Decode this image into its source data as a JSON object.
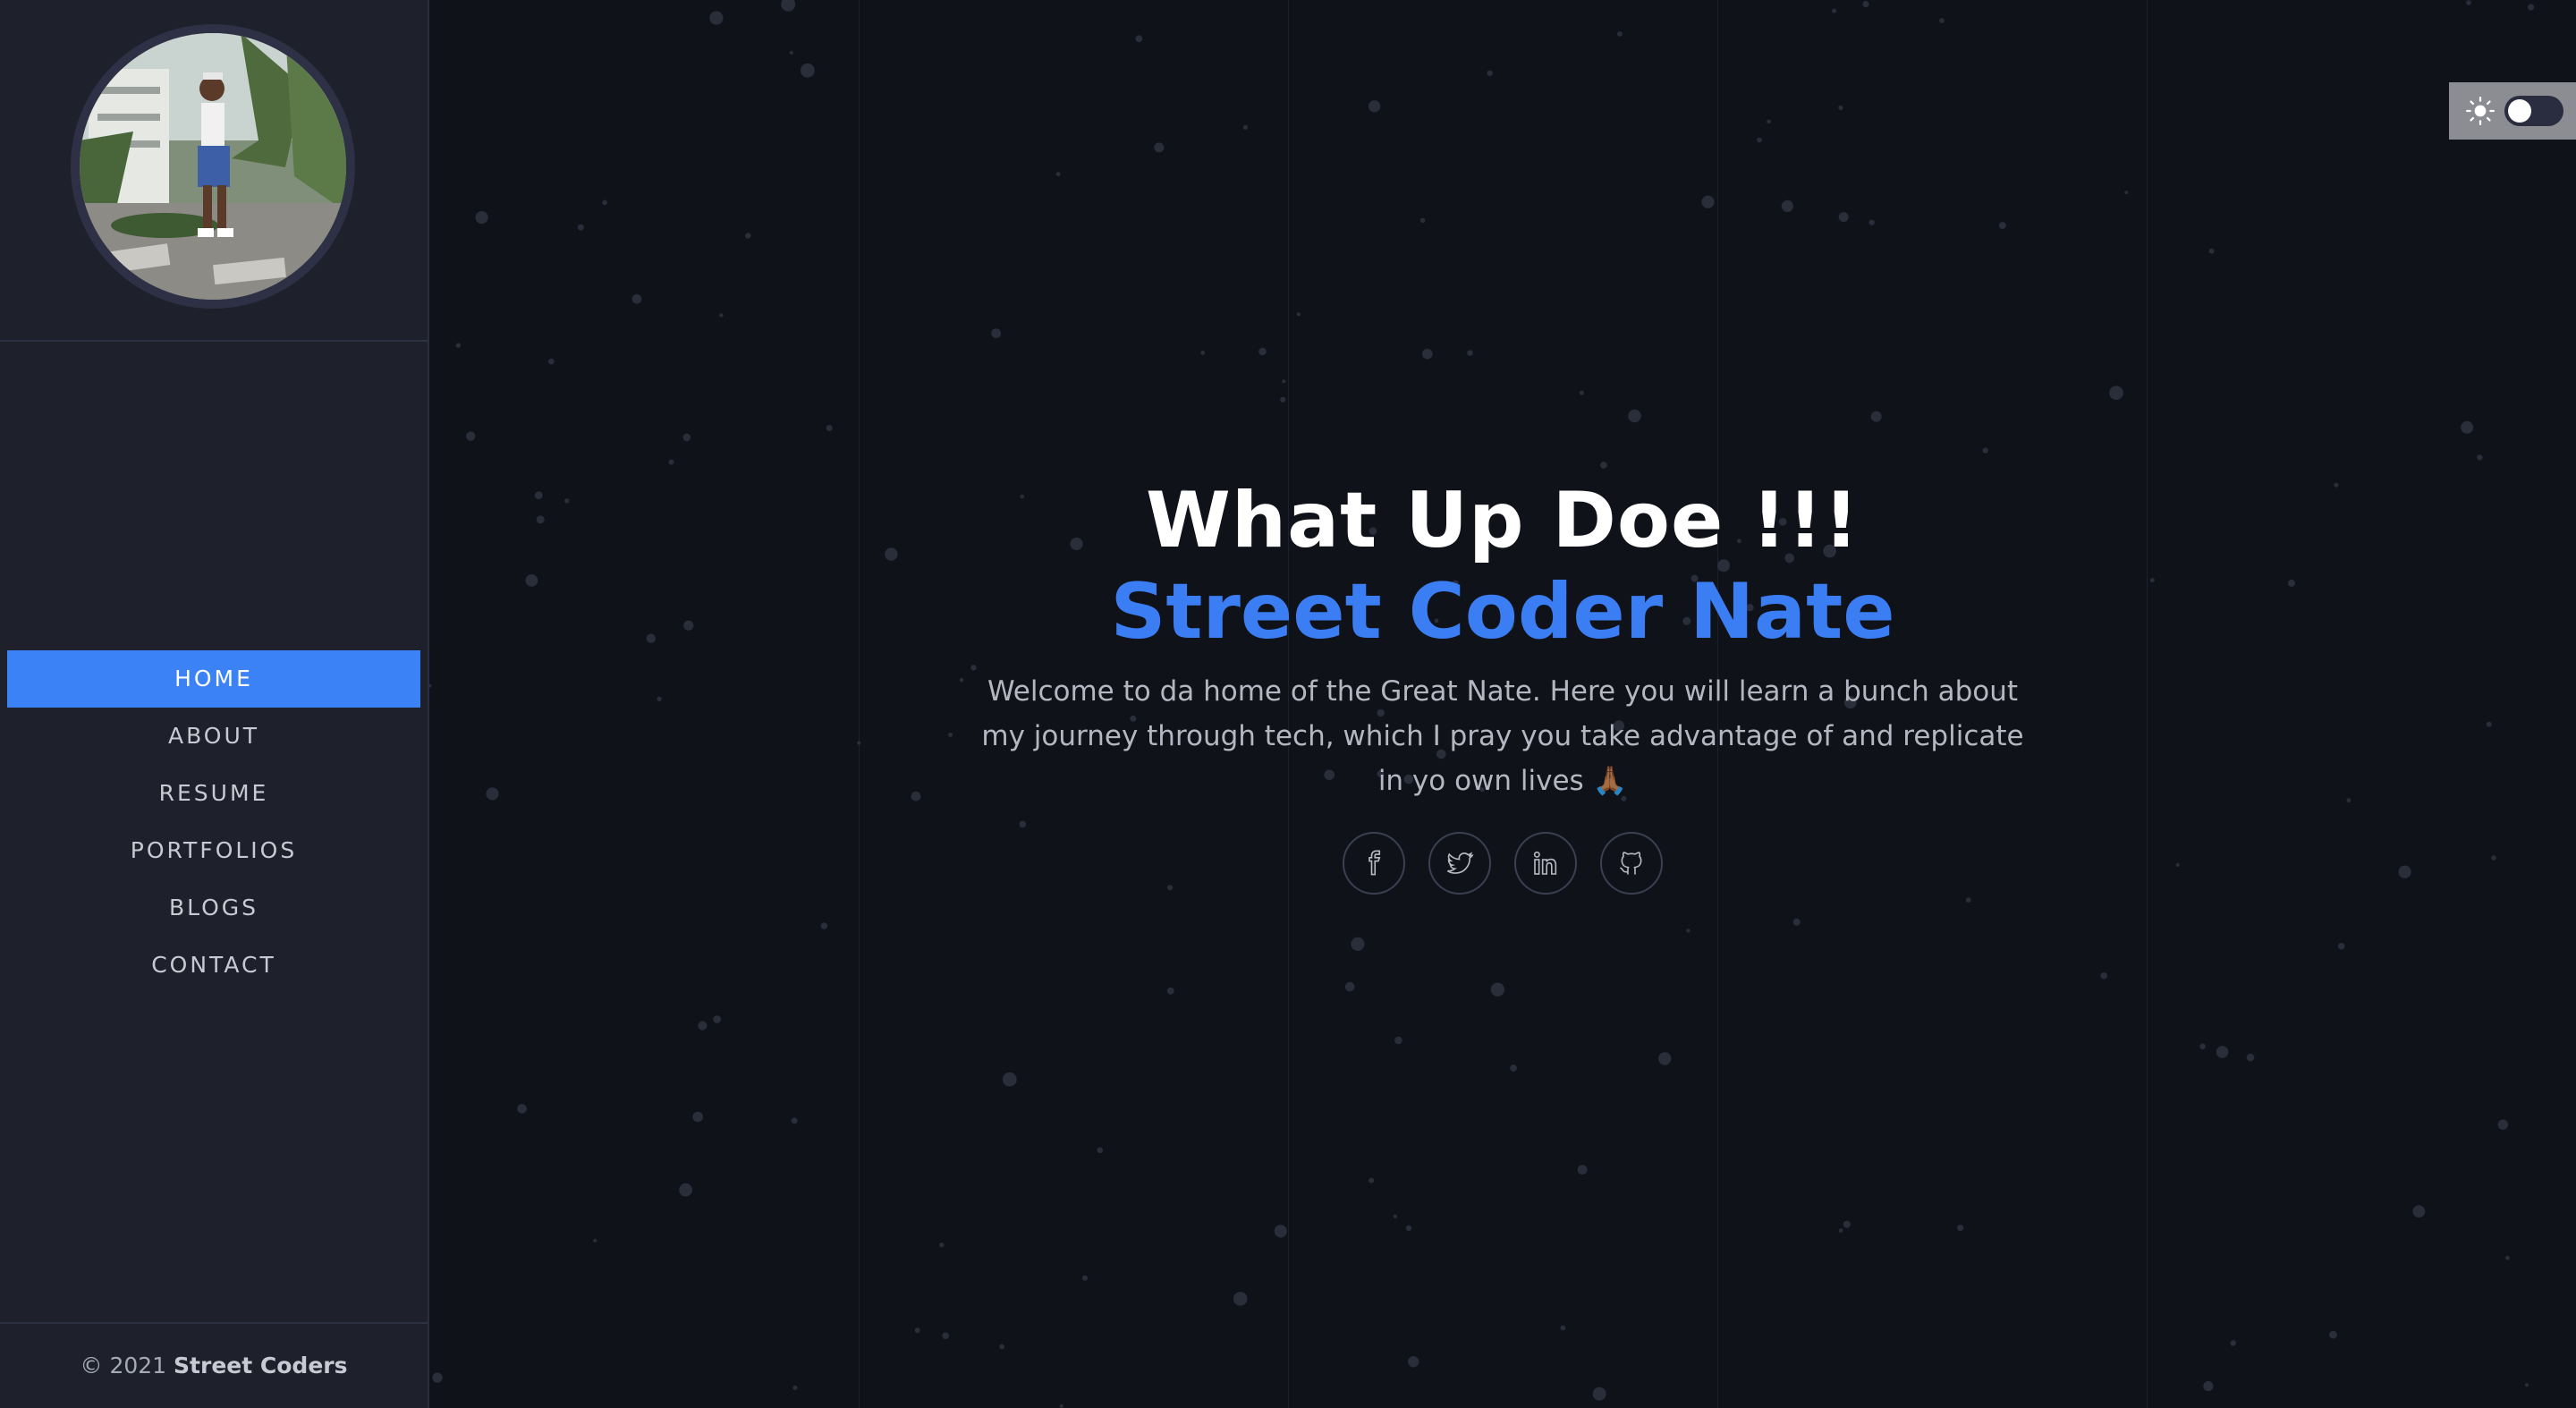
{
  "sidebar": {
    "nav": [
      {
        "label": "Home",
        "active": true
      },
      {
        "label": "About",
        "active": false
      },
      {
        "label": "Resume",
        "active": false
      },
      {
        "label": "Portfolios",
        "active": false
      },
      {
        "label": "Blogs",
        "active": false
      },
      {
        "label": "Contact",
        "active": false
      }
    ],
    "footer": {
      "copyright": "© 2021",
      "brand": "Street Coders"
    }
  },
  "hero": {
    "title": "What Up Doe !!!",
    "name": "Street Coder Nate",
    "text": "Welcome to da home of the Great Nate. Here you will learn a bunch about my journey through tech, which I pray you take advantage of and replicate in yo own lives 🙏🏾"
  },
  "socials": [
    {
      "icon": "facebook-icon"
    },
    {
      "icon": "twitter-icon"
    },
    {
      "icon": "linkedin-icon"
    },
    {
      "icon": "github-icon"
    }
  ],
  "theme_toggle": {
    "icon": "sun-icon",
    "dark_mode": true
  },
  "colors": {
    "accent": "#3b82f6",
    "background": "#10121a",
    "sidebar": "#1e202c"
  }
}
